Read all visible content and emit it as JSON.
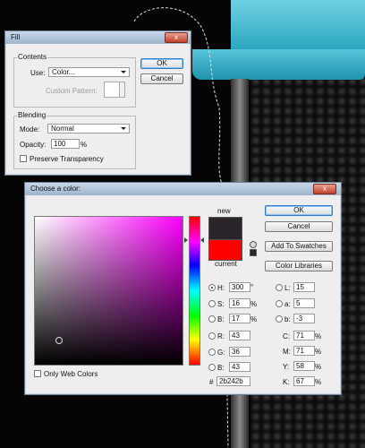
{
  "colors": {
    "new": "#2b242b",
    "current": "#ff0000",
    "hue": "#ff00ff",
    "turquoise": "#3fb3c8",
    "title_gradient_top": "#c7d7e8"
  },
  "fill_dialog": {
    "title": "Fill",
    "close": "x",
    "ok": "OK",
    "cancel": "Cancel",
    "contents_label": "Contents",
    "use_label": "Use:",
    "use_value": "Color...",
    "custom_pattern_label": "Custom Pattern:",
    "blending_label": "Blending",
    "mode_label": "Mode:",
    "mode_value": "Normal",
    "opacity_label": "Opacity:",
    "opacity_value": "100",
    "opacity_unit": "%",
    "preserve_label": "Preserve Transparency"
  },
  "color_picker": {
    "title": "Choose a color:",
    "close": "x",
    "ok": "OK",
    "cancel": "Cancel",
    "add_swatches": "Add To Swatches",
    "color_libraries": "Color Libraries",
    "new_label": "new",
    "current_label": "current",
    "only_web": "Only Web Colors",
    "hex_label": "#",
    "hex_value": "2b242b",
    "fields": {
      "H": {
        "label": "H:",
        "value": "300",
        "unit": "°"
      },
      "S": {
        "label": "S:",
        "value": "16",
        "unit": "%"
      },
      "B": {
        "label": "B:",
        "value": "17",
        "unit": "%"
      },
      "R": {
        "label": "R:",
        "value": "43",
        "unit": ""
      },
      "G": {
        "label": "G:",
        "value": "36",
        "unit": ""
      },
      "Bl": {
        "label": "B:",
        "value": "43",
        "unit": ""
      },
      "L": {
        "label": "L:",
        "value": "15",
        "unit": ""
      },
      "a": {
        "label": "a:",
        "value": "5",
        "unit": ""
      },
      "b": {
        "label": "b:",
        "value": "-3",
        "unit": ""
      },
      "C": {
        "label": "C:",
        "value": "71",
        "unit": "%"
      },
      "M": {
        "label": "M:",
        "value": "71",
        "unit": "%"
      },
      "Y": {
        "label": "Y:",
        "value": "58",
        "unit": "%"
      },
      "K": {
        "label": "K:",
        "value": "67",
        "unit": "%"
      }
    }
  }
}
